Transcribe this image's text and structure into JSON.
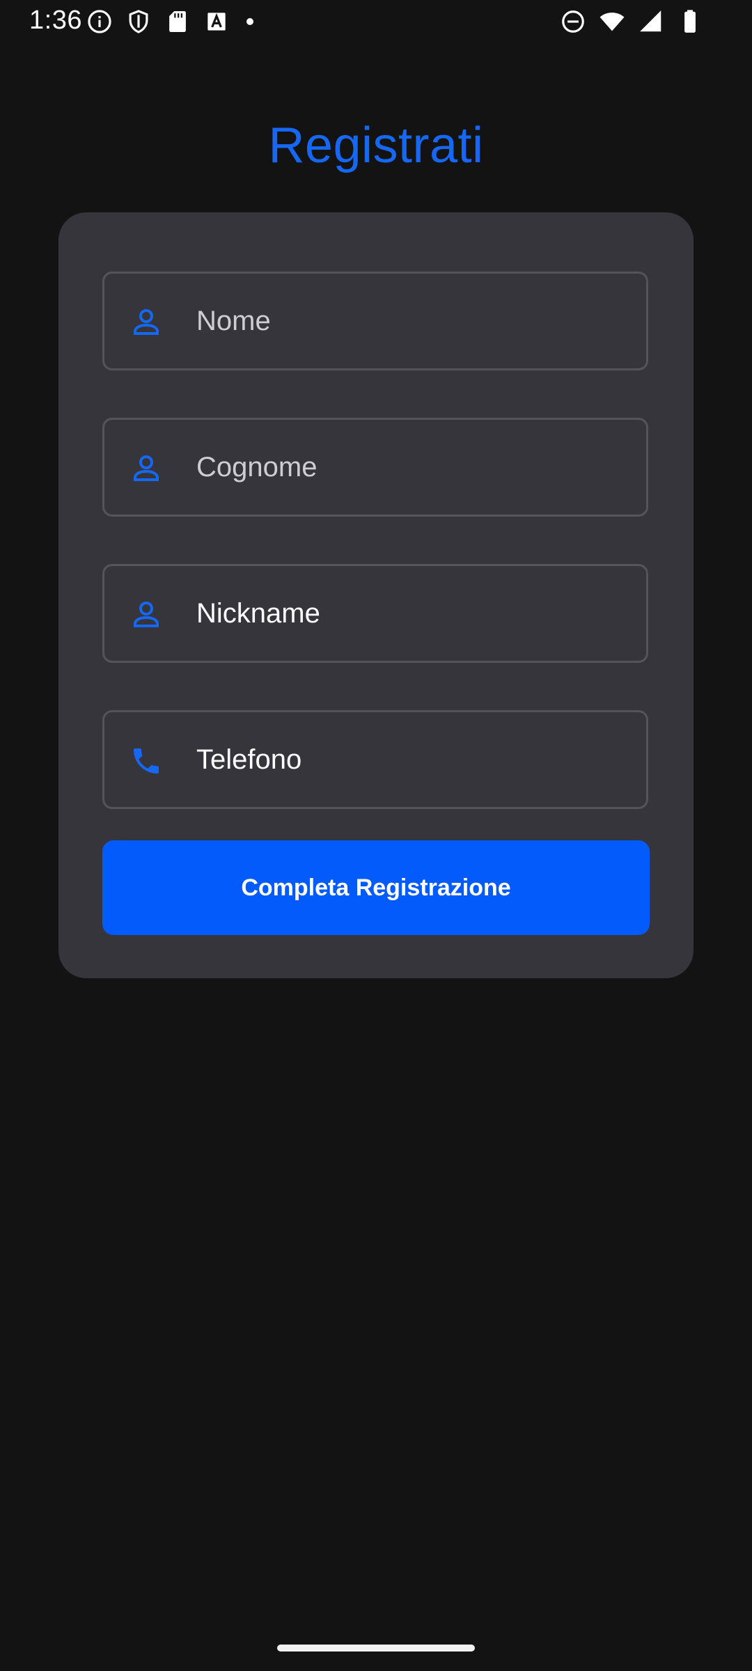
{
  "status_bar": {
    "time": "1:36",
    "left_icons": [
      "info-icon",
      "shield-icon",
      "sd-card-icon",
      "text-a-icon",
      "dot-icon"
    ],
    "right_icons": [
      "do-not-disturb-icon",
      "wifi-icon",
      "signal-icon",
      "battery-icon"
    ]
  },
  "title": "Registrati",
  "form": {
    "fields": [
      {
        "icon": "person-icon",
        "placeholder": "Nome",
        "value": ""
      },
      {
        "icon": "person-icon",
        "placeholder": "Cognome",
        "value": ""
      },
      {
        "icon": "person-icon",
        "placeholder": "Nickname",
        "value": "Nickname"
      },
      {
        "icon": "phone-icon",
        "placeholder": "Telefono",
        "value": "Telefono"
      }
    ],
    "submit_label": "Completa Registrazione"
  },
  "colors": {
    "accent": "#1668f2",
    "button": "#045bfc",
    "background": "#131314",
    "card": "#36353b"
  }
}
